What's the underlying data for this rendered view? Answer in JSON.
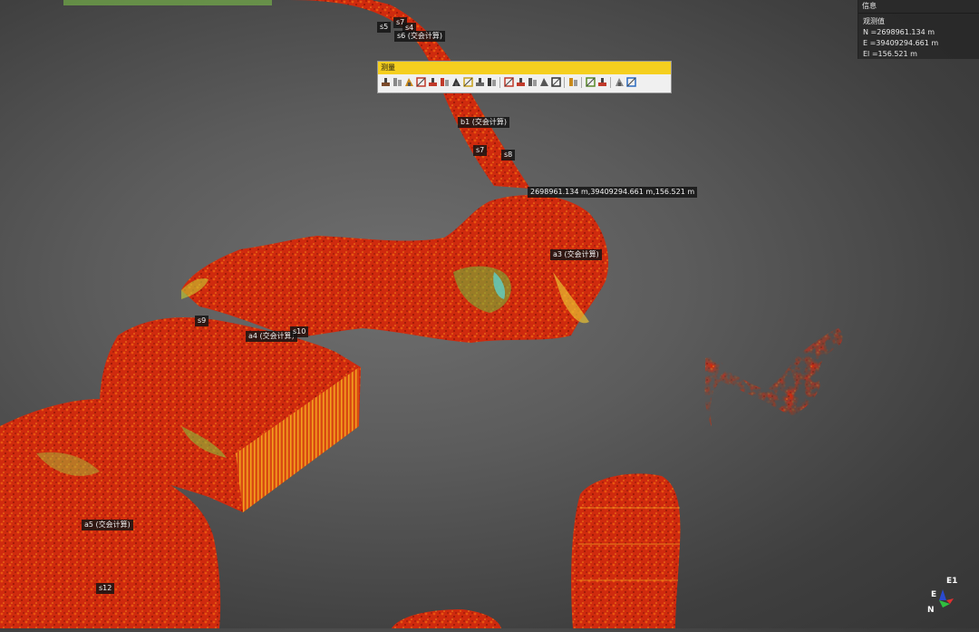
{
  "info_panel": {
    "header": "信息",
    "section": "观测值",
    "north": "N =2698961.134 m",
    "east": "E =39409294.661 m",
    "elevation": "El =156.521 m"
  },
  "measure_toolbar": {
    "title": "测量",
    "tools": [
      {
        "icon": "distance-icon",
        "color": "#7a4a2a"
      },
      {
        "icon": "area-icon",
        "color": "#888888"
      },
      {
        "icon": "height-icon",
        "color": "#c98a1c"
      },
      {
        "icon": "vertical-measure-icon",
        "color": "#c03a2a"
      },
      {
        "icon": "wall-measure-icon",
        "color": "#c03a2a"
      },
      {
        "icon": "plane-measure-icon",
        "color": "#c03a2a"
      },
      {
        "icon": "slope-icon",
        "color": "#333333"
      },
      {
        "icon": "angle-icon",
        "color": "#c9a31c"
      },
      {
        "icon": "point-icon",
        "color": "#666666"
      },
      {
        "icon": "ground-icon",
        "color": "#333333"
      },
      {
        "sep": true
      },
      {
        "icon": "intersection-icon",
        "color": "#c03a2a"
      },
      {
        "icon": "line-intersection-icon",
        "color": "#c03a2a"
      },
      {
        "icon": "grid-icon",
        "color": "#555555"
      },
      {
        "icon": "mesh-icon",
        "color": "#555555"
      },
      {
        "icon": "export-points-icon",
        "color": "#333333"
      },
      {
        "sep": true
      },
      {
        "icon": "compare-icon",
        "color": "#c98a1c"
      },
      {
        "sep": true
      },
      {
        "icon": "tag-icon",
        "color": "#5a8a2a"
      },
      {
        "icon": "delete-icon",
        "color": "#c03a2a"
      },
      {
        "sep": true
      },
      {
        "icon": "report-icon",
        "color": "#888888"
      },
      {
        "icon": "layers-icon",
        "color": "#2a6ac0"
      }
    ]
  },
  "coordinate_label": "2698961.134 m,39409294.661 m,156.521 m",
  "labels": [
    {
      "name": "s5",
      "text": "s5"
    },
    {
      "name": "s7-top",
      "text": "s7"
    },
    {
      "name": "s4",
      "text": "s4"
    },
    {
      "name": "s6",
      "text": "s6 (交会计算)"
    },
    {
      "name": "b1",
      "text": "b1 (交会计算)"
    },
    {
      "name": "s7",
      "text": "s7"
    },
    {
      "name": "s8",
      "text": "s8"
    },
    {
      "name": "a3",
      "text": "a3 (交会计算)"
    },
    {
      "name": "s9",
      "text": "s9"
    },
    {
      "name": "a4",
      "text": "a4 (交会计算)"
    },
    {
      "name": "s10",
      "text": "s10"
    },
    {
      "name": "a5",
      "text": "a5 (交会计算)"
    },
    {
      "name": "s12",
      "text": "s12"
    }
  ],
  "axis": {
    "e1": "E1",
    "e": "E",
    "n": "N"
  }
}
